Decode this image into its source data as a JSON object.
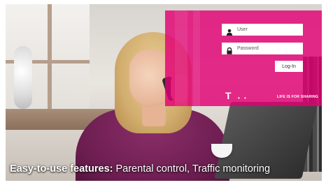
{
  "login": {
    "user_placeholder": "User",
    "password_placeholder": "Password",
    "login_label": "Log-In"
  },
  "brand": {
    "logo_text": "T",
    "logo_dots": "• •",
    "slogan": "LIFE IS FOR SHARING",
    "accent_color": "#e20074"
  },
  "caption": {
    "bold": "Easy-to-use features:",
    "text": " Parental control, Traffic monitoring"
  },
  "icons": [
    "user-icon",
    "lock-icon"
  ]
}
